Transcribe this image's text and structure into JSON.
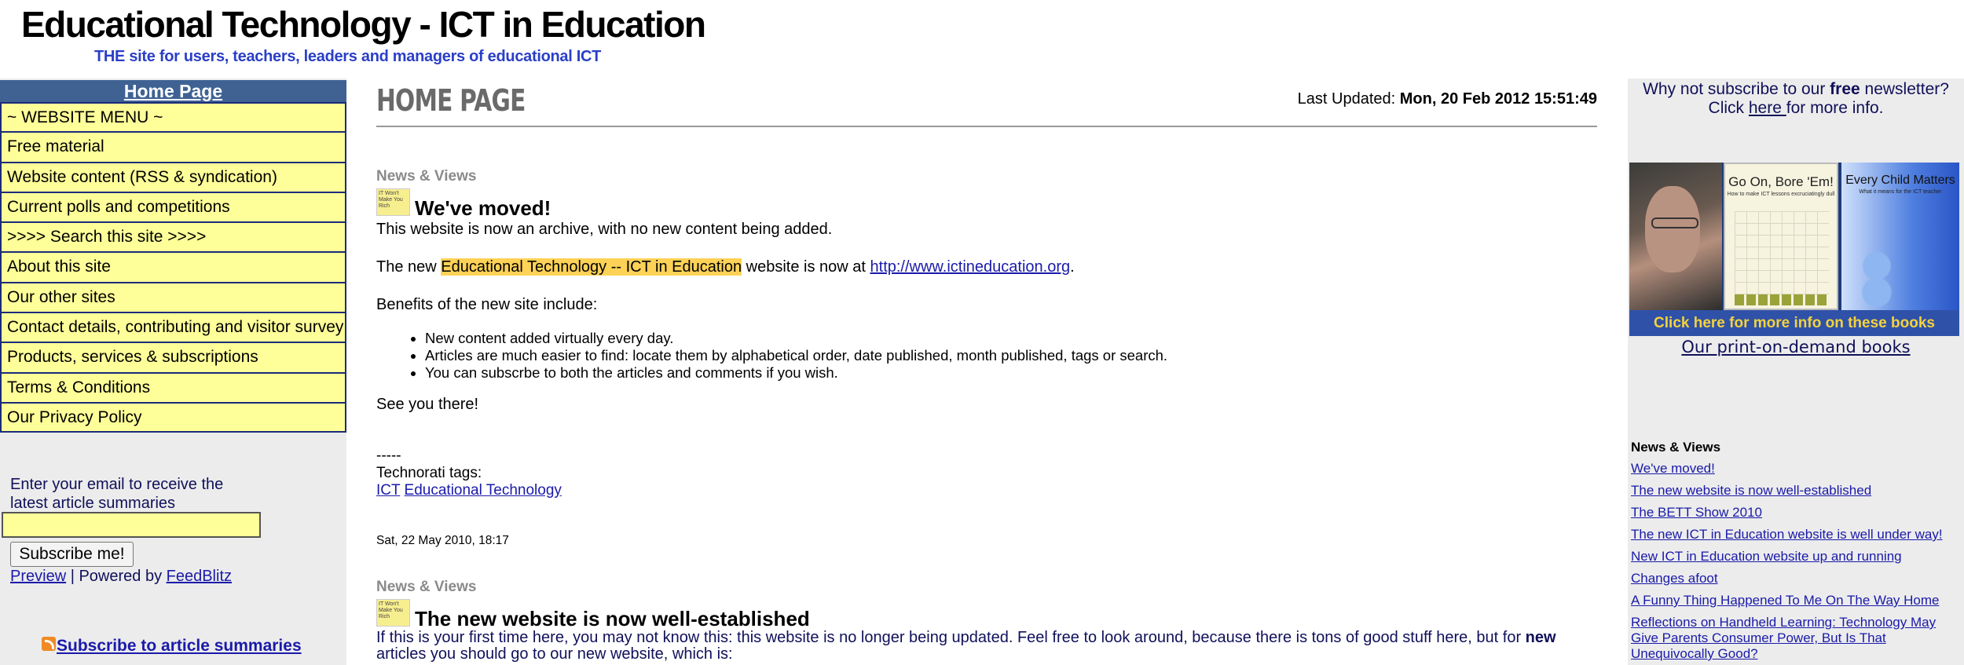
{
  "header": {
    "title": "Educational Technology - ICT in Education",
    "tagline": "THE site for users, teachers, leaders and managers of educational ICT"
  },
  "left": {
    "home_label": "Home Page",
    "menu": [
      "~ WEBSITE MENU ~",
      "Free material",
      "Website content (RSS & syndication)",
      "Current polls and competitions",
      ">>>> Search this site >>>>",
      "About this site",
      "Our other sites",
      "Contact details, contributing and visitor survey",
      "Products, services & subscriptions",
      "Terms & Conditions",
      "Our Privacy Policy"
    ],
    "subscribe_label": "Enter your email to receive the latest article summaries",
    "subscribe_button": "Subscribe me!",
    "preview_link": "Preview",
    "powered_sep": " | Powered by ",
    "feedblitz_link": "FeedBlitz",
    "rss_link": "Subscribe to article summaries"
  },
  "main": {
    "heading": "HOME PAGE",
    "last_updated_label": "Last Updated: ",
    "last_updated_value": "Mon, 20 Feb 2012 15:51:49",
    "post1": {
      "category": "News & Views",
      "icon_text": "IT Won't Make You Rich",
      "title": "We've moved!",
      "line1": "This website is now an archive, with no new content being added.",
      "line2_pre": "The new ",
      "line2_highlight": "Educational Technology -- ICT in Education",
      "line2_mid": " website is now at ",
      "line2_link": "http://www.ictineducation.org",
      "line2_post": ".",
      "benefits_intro": "Benefits of the new site include:",
      "benefits": [
        "New content added virtually every day.",
        "Articles are much easier to find: locate them by alphabetical order, date published, month published, tags or search.",
        "You can subscrbe to both the articles and comments if you wish."
      ],
      "closing": "See you there!",
      "dashes": "-----",
      "tags_label": "Technorati tags:",
      "tag1": "ICT",
      "tag2": "Educational Technology",
      "date": "Sat, 22 May 2010, 18:17"
    },
    "post2": {
      "category": "News & Views",
      "icon_text": "IT Won't Make You Rich",
      "title": "The new website is now well-established",
      "body_pre": "If this is your first time here, you may not know this: this website is no longer being updated. Feel free to look around, because there is tons of good stuff here, but for ",
      "body_bold": "new",
      "body_post": " articles you should go to our new website, which is:"
    }
  },
  "right": {
    "newsletter_pre": "Why not subscribe to our ",
    "newsletter_bold": "free",
    "newsletter_mid": " newsletter?",
    "newsletter_click": "Click ",
    "newsletter_link": "here ",
    "newsletter_post": "for more info.",
    "book2_title": "Go On, Bore 'Em!",
    "book2_sub": "How to make ICT lessons excruciatingly dull",
    "book3_title": "Every Child Matters",
    "book3_sub": "What it means for the ICT teacher",
    "books_caption": "Click here for more info on these books",
    "pod_link": "Our print-on-demand books",
    "news_heading": "News & Views",
    "news_items": [
      "We've moved!",
      "The new website is now well-established",
      "The BETT Show 2010",
      "The new ICT in Education website is well under way!",
      "New ICT in Education website up and running",
      "Changes afoot",
      "A Funny Thing Happened To Me On The Way Home",
      "Reflections on Handheld Learning: Technology May Give Parents Consumer Power, But Is That Unequivocally Good?"
    ]
  }
}
